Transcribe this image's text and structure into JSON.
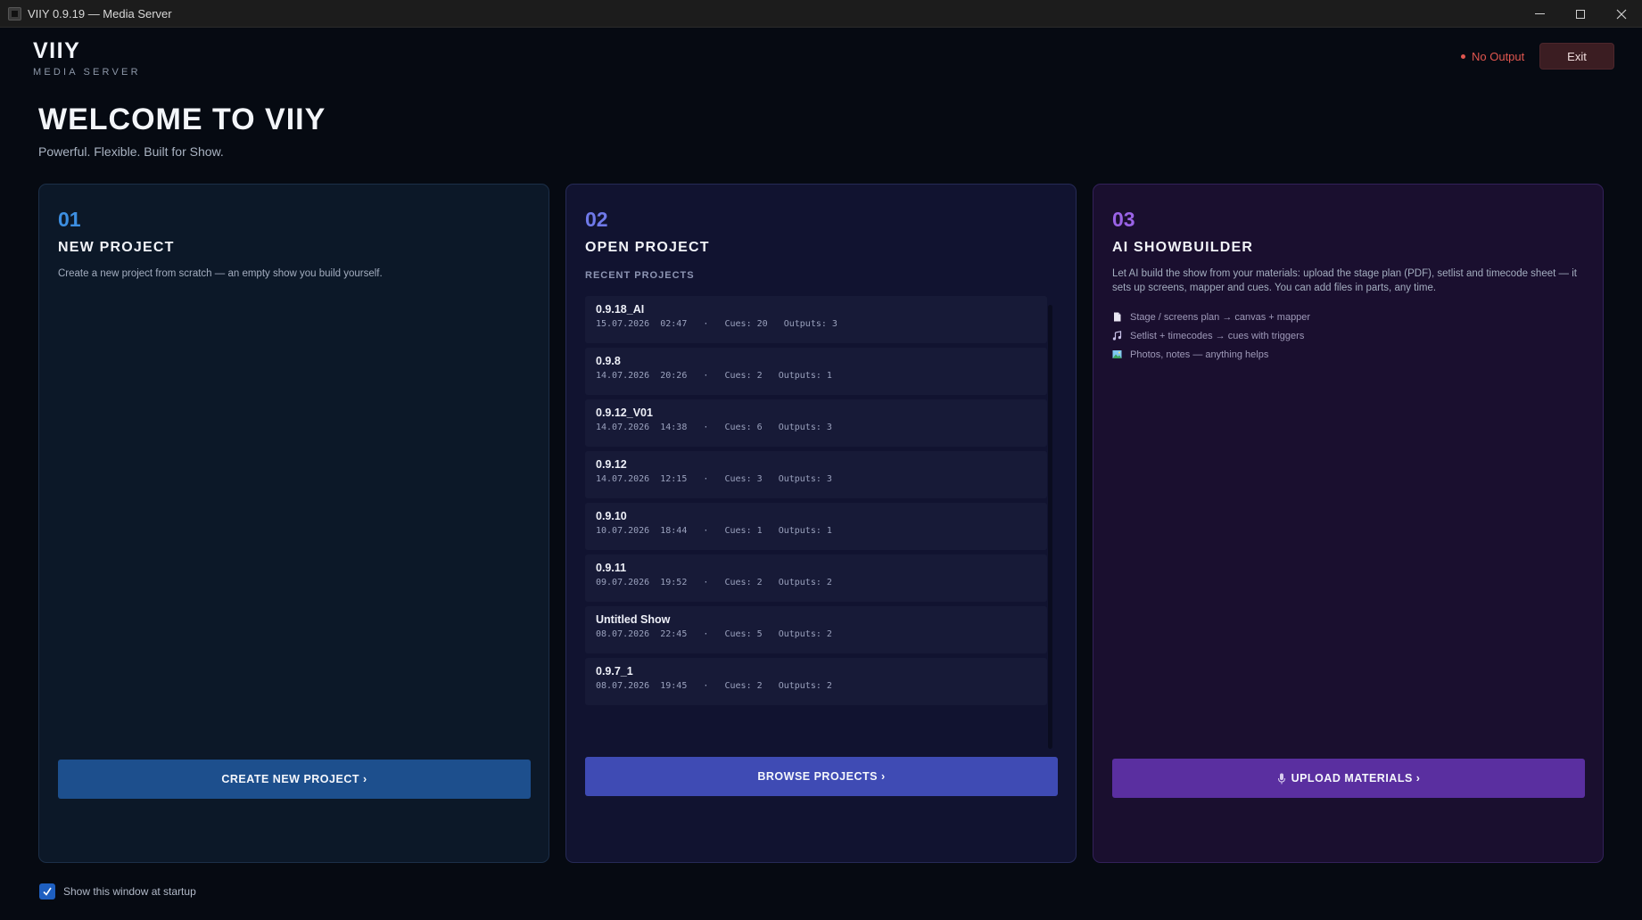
{
  "window": {
    "title": "VIIY 0.9.19 — Media Server"
  },
  "header": {
    "brand": "VIIY",
    "brand_sub": "MEDIA SERVER",
    "status": "No Output",
    "exit_label": "Exit"
  },
  "welcome": {
    "title": "WELCOME TO VIIY",
    "subtitle": "Powerful. Flexible. Built for Show."
  },
  "panels": {
    "new_project": {
      "number": "01",
      "title": "NEW PROJECT",
      "description": "Create a new project from scratch — an empty show you build yourself.",
      "button": "CREATE NEW PROJECT ›"
    },
    "open_project": {
      "number": "02",
      "title": "OPEN PROJECT",
      "section_label": "RECENT PROJECTS",
      "button": "BROWSE PROJECTS ›",
      "recent": [
        {
          "name": "0.9.18_AI",
          "meta": "15.07.2026  02:47   ·   Cues: 20   Outputs: 3"
        },
        {
          "name": "0.9.8",
          "meta": "14.07.2026  20:26   ·   Cues: 2   Outputs: 1"
        },
        {
          "name": "0.9.12_V01",
          "meta": "14.07.2026  14:38   ·   Cues: 6   Outputs: 3"
        },
        {
          "name": "0.9.12",
          "meta": "14.07.2026  12:15   ·   Cues: 3   Outputs: 3"
        },
        {
          "name": "0.9.10",
          "meta": "10.07.2026  18:44   ·   Cues: 1   Outputs: 1"
        },
        {
          "name": "0.9.11",
          "meta": "09.07.2026  19:52   ·   Cues: 2   Outputs: 2"
        },
        {
          "name": "Untitled Show",
          "meta": "08.07.2026  22:45   ·   Cues: 5   Outputs: 2"
        },
        {
          "name": "0.9.7_1",
          "meta": "08.07.2026  19:45   ·   Cues: 2   Outputs: 2"
        }
      ]
    },
    "ai_showbuilder": {
      "number": "03",
      "title": "AI SHOWBUILDER",
      "description": "Let AI build the show from your materials: upload the stage plan (PDF), setlist and timecode sheet — it sets up screens, mapper and cues. You can add files in parts, any time.",
      "features": [
        {
          "icon": "document-icon",
          "text": "Stage / screens plan → canvas + mapper"
        },
        {
          "icon": "music-note-icon",
          "text": "Setlist + timecodes → cues with triggers"
        },
        {
          "icon": "image-icon",
          "text": "Photos, notes — anything helps"
        }
      ],
      "button": "UPLOAD MATERIALS ›"
    }
  },
  "footer": {
    "startup_label": "Show this window at startup",
    "startup_checked": true
  },
  "colors": {
    "accent_blue": "#3d8fe2",
    "accent_indigo": "#6f79e9",
    "accent_purple": "#9a63e6",
    "status_red": "#e0564f"
  }
}
